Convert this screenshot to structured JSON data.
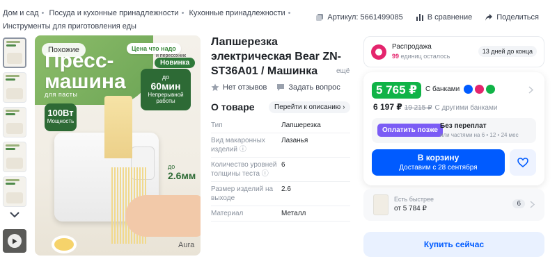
{
  "breadcrumbs": [
    "Дом и сад",
    "Посуда и кухонные принадлежности",
    "Кухонные принадлежности",
    "Инструменты для приготовления еды"
  ],
  "top_meta": {
    "article": "Артикул: 5661499085",
    "compare": "В сравнение",
    "share": "Поделиться"
  },
  "gallery": {
    "badge": "Похожие",
    "image_text": {
      "title_line1": "Пресс-",
      "title_line2": "машина",
      "subtitle": "для пасты",
      "time_pill": "Цена что надо",
      "time_pill_sub": "и пересохник",
      "new": "Новинка",
      "card_up_to": "до",
      "card_value": "60мин",
      "card_desc": "Непрерывной работы",
      "power_value": "100Вт",
      "power_label": "Мощность",
      "size_up_to": "до",
      "size_value": "2.6мм",
      "brand": "Aura"
    }
  },
  "product": {
    "title": "Лапшерезка электрическая Bear ZN-ST36A01 / Машинка",
    "more": "ещё",
    "reviews": "Нет отзывов",
    "ask": "Задать вопрос",
    "about_heading": "О товаре",
    "goto_desc": "Перейти к описанию",
    "specs": [
      {
        "k": "Тип",
        "v": "Лапшерезка"
      },
      {
        "k": "Вид макаронных изделий",
        "v": "Лазанья"
      },
      {
        "k": "Количество уровней толщины теста",
        "v": "6"
      },
      {
        "k": "Размер изделий на выходе",
        "v": "2.6"
      },
      {
        "k": "Материал",
        "v": "Металл"
      }
    ]
  },
  "sale": {
    "title": "Распродажа",
    "remaining_num": "99",
    "remaining_txt": "единиц осталось",
    "days_left": "13 дней до конца"
  },
  "price": {
    "main": "5 765 ₽",
    "main_label": "С банками",
    "other": "6 197 ₽",
    "old": "19 215 ₽",
    "other_label": "С другими банками",
    "pay_later_btn": "Оплатить позже",
    "no_overpay": "Без переплат",
    "installments": "или частями на 6 • 12 • 24 мес",
    "cart_label": "В корзину",
    "delivery": "Доставим с 28 сентября"
  },
  "faster": {
    "label": "Есть быстрее",
    "price": "от 5 784 ₽",
    "count": "6"
  },
  "buy_now": "Купить сейчас",
  "colors": {
    "accent_blue": "#005bff",
    "price_green": "#10b347",
    "sale_pink": "#e4256d",
    "pay_later_purple": "#7b5cf5"
  }
}
